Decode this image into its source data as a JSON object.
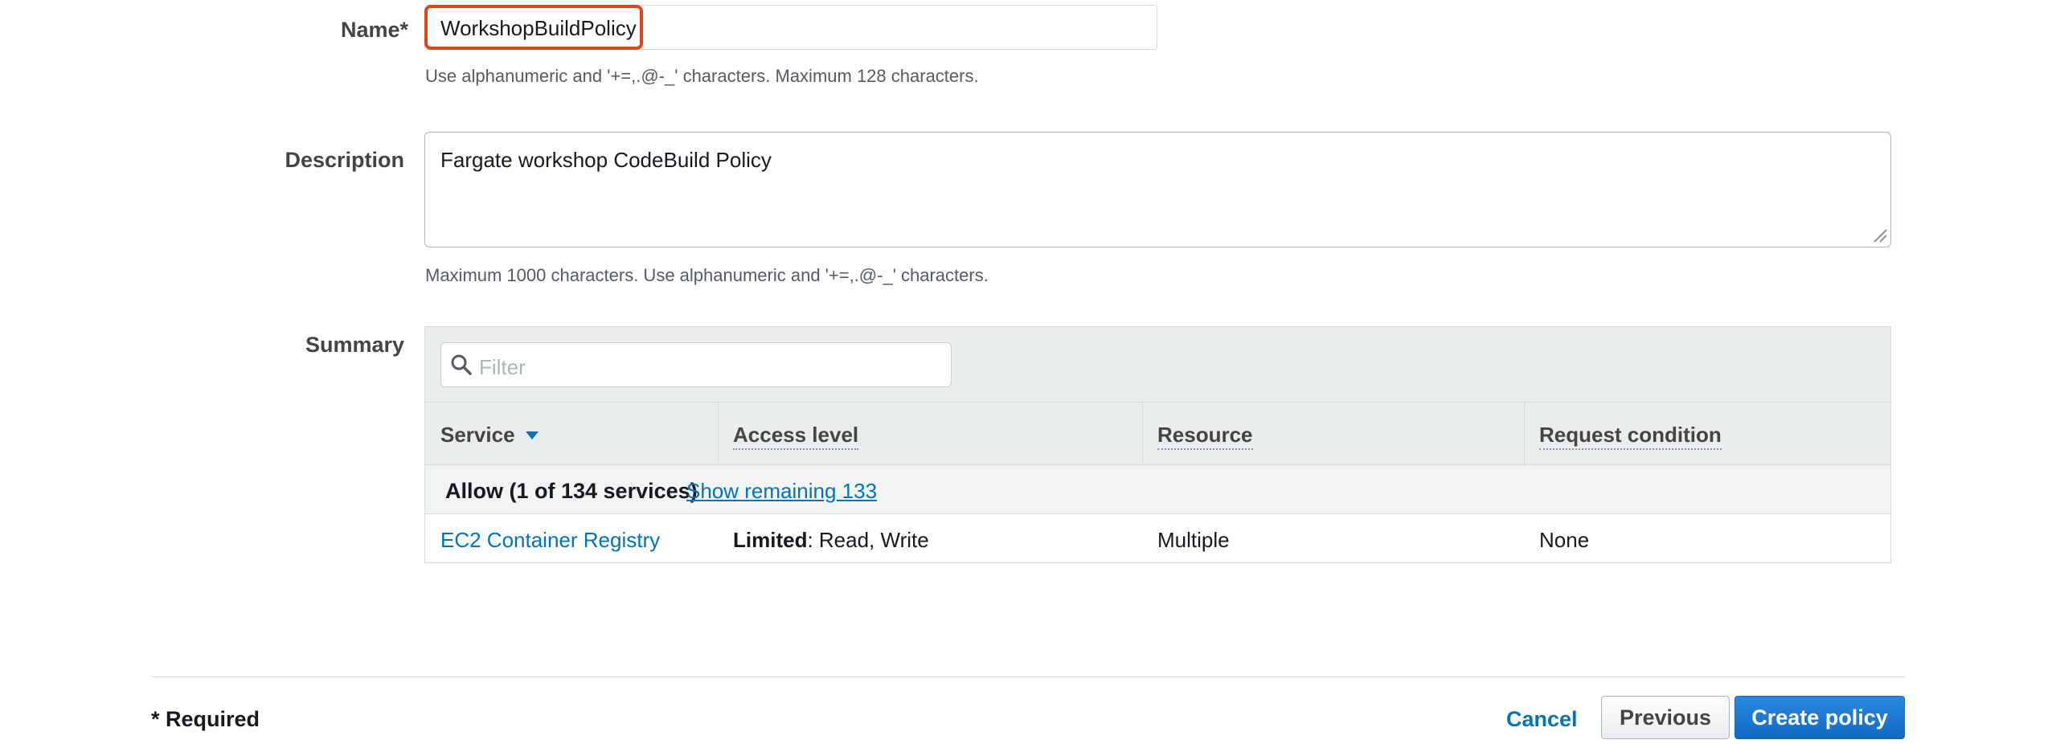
{
  "form": {
    "name_label": "Name*",
    "name_value": "WorkshopBuildPolicy",
    "name_hint": "Use alphanumeric and '+=,.@-_' characters. Maximum 128 characters.",
    "description_label": "Description",
    "description_value": "Fargate workshop CodeBuild Policy",
    "description_hint": "Maximum 1000 characters. Use alphanumeric and '+=,.@-_' characters.",
    "summary_label": "Summary"
  },
  "summary": {
    "filter_placeholder": "Filter",
    "columns": [
      "Service",
      "Access level",
      "Resource",
      "Request condition"
    ],
    "group": {
      "text": "Allow (1 of 134 services)",
      "link": "Show remaining 133"
    },
    "rows": [
      {
        "service": "EC2 Container Registry",
        "access_bold": "Limited",
        "access_rest": ": Read, Write",
        "resource": "Multiple",
        "condition": "None"
      }
    ]
  },
  "footer": {
    "required_note": "* Required",
    "cancel": "Cancel",
    "previous": "Previous",
    "create": "Create policy"
  },
  "colors": {
    "highlight": "#e0461e",
    "link": "#0073bb",
    "primary": "#1169c6"
  }
}
